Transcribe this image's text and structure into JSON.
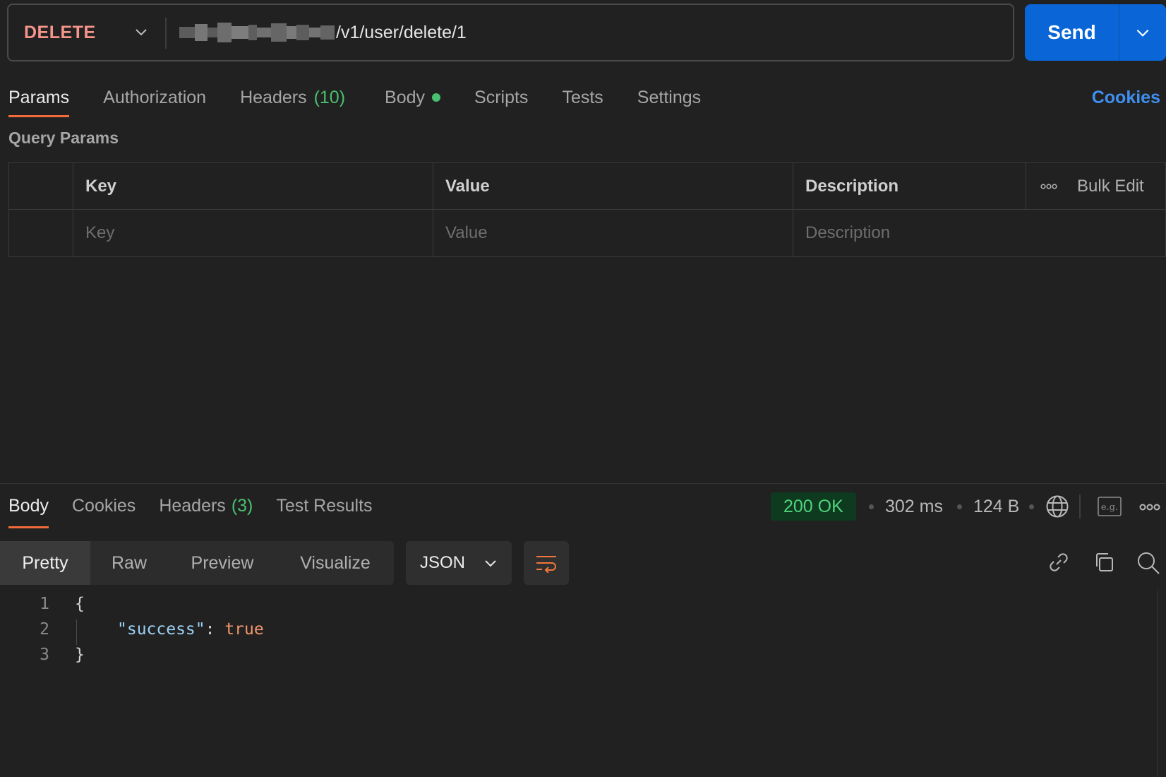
{
  "request": {
    "method": "DELETE",
    "url_path": "/v1/user/delete/1",
    "send_label": "Send"
  },
  "request_tabs": [
    {
      "label": "Params"
    },
    {
      "label": "Authorization"
    },
    {
      "label": "Headers",
      "count": "(10)"
    },
    {
      "label": "Body"
    },
    {
      "label": "Scripts"
    },
    {
      "label": "Tests"
    },
    {
      "label": "Settings"
    }
  ],
  "cookies_label": "Cookies",
  "query_params": {
    "title": "Query Params",
    "columns": [
      "Key",
      "Value",
      "Description"
    ],
    "placeholders": [
      "Key",
      "Value",
      "Description"
    ],
    "bulk_edit": "Bulk Edit"
  },
  "response": {
    "tabs": [
      {
        "label": "Body"
      },
      {
        "label": "Cookies"
      },
      {
        "label": "Headers",
        "count": "(3)"
      },
      {
        "label": "Test Results"
      }
    ],
    "status": "200 OK",
    "time": "302 ms",
    "size": "124 B",
    "view_modes": [
      "Pretty",
      "Raw",
      "Preview",
      "Visualize"
    ],
    "format": "JSON",
    "code": {
      "line_numbers": [
        "1",
        "2",
        "3"
      ],
      "open_brace": "{",
      "key": "\"success\"",
      "colon": ": ",
      "value": "true",
      "close_brace": "}"
    }
  },
  "colors": {
    "method": "#f5948a",
    "send": "#0a66d6",
    "accent_underline": "#f26b3a",
    "count_green": "#49c06f",
    "link_blue": "#3f8ff0",
    "status_bg": "#0e3a1f",
    "status_text": "#4fd47c"
  },
  "icons": [
    "chevron-down-icon",
    "globe-icon",
    "example-icon",
    "more-icon",
    "wrap-icon",
    "link-icon",
    "copy-icon",
    "search-icon"
  ]
}
